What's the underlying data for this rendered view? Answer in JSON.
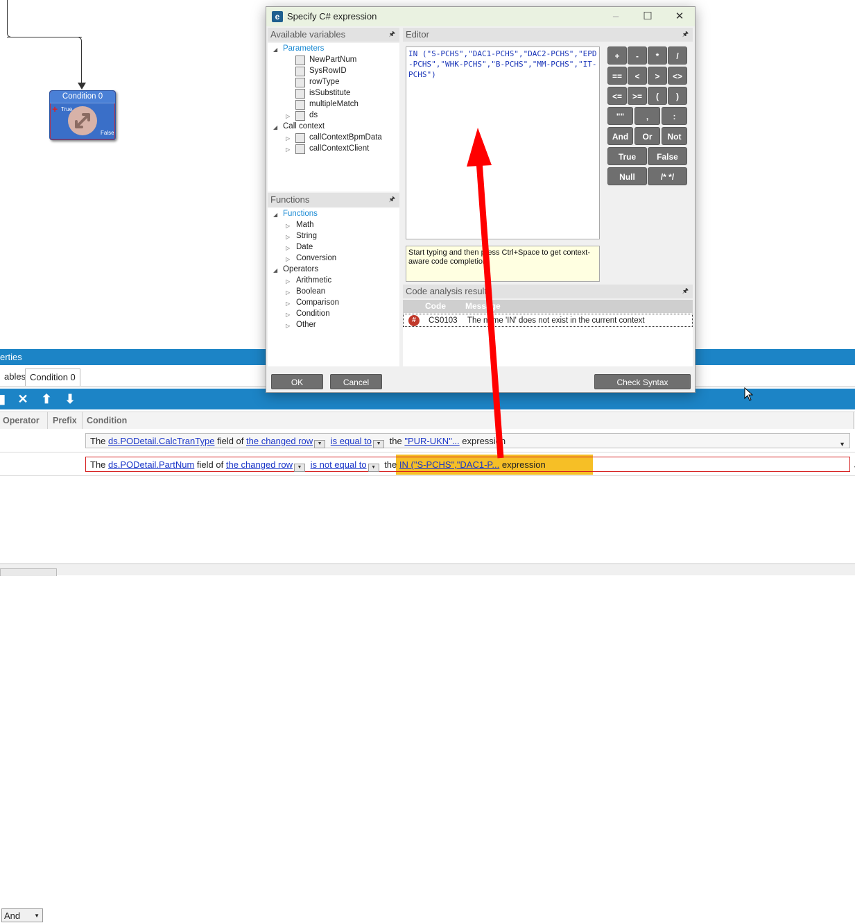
{
  "node": {
    "title": "Condition 0",
    "true_label": "True",
    "false_label": "False"
  },
  "properties": {
    "header": "erties",
    "tabs": [
      "ables",
      "Condition 0"
    ],
    "columns": {
      "operator": "Operator",
      "prefix": "Prefix",
      "condition": "Condition"
    },
    "rows": [
      {
        "operator": "",
        "parts": {
          "t1": "The",
          "field": "ds.PODetail.CalcTranType",
          "t2": "field of",
          "row": "the changed row",
          "op": "is equal to",
          "t3": "the",
          "value": "\"PUR-UKN\"...",
          "t4": "expression"
        }
      },
      {
        "operator": "And",
        "parts": {
          "t1": "The",
          "field": "ds.PODetail.PartNum",
          "t2": "field of",
          "row": "the changed row",
          "op": "is not equal to",
          "t3": "the",
          "value": "IN (\"S-PCHS\",\"DAC1-P...",
          "t4": "expression"
        }
      }
    ]
  },
  "dialog": {
    "title": "Specify C# expression",
    "vars_header": "Available variables",
    "tree_vars": {
      "parameters": "Parameters",
      "params": [
        "NewPartNum",
        "SysRowID",
        "rowType",
        "isSubstitute",
        "multipleMatch",
        "ds"
      ],
      "call_context": "Call context",
      "call_items": [
        "callContextBpmData",
        "callContextClient"
      ]
    },
    "functions_header": "Functions",
    "tree_funcs": {
      "functions": "Functions",
      "func_items": [
        "Math",
        "String",
        "Date",
        "Conversion"
      ],
      "operators": "Operators",
      "op_items": [
        "Arithmetic",
        "Boolean",
        "Comparison",
        "Condition",
        "Other"
      ]
    },
    "editor_header": "Editor",
    "editor_text": "IN (\"S-PCHS\",\"DAC1-PCHS\",\"DAC2-PCHS\",\"EPD-PCHS\",\"WHK-PCHS\",\"B-PCHS\",\"MM-PCHS\",\"IT-PCHS\")",
    "hint": "Start typing and then press Ctrl+Space to get context-aware code completion",
    "calc": [
      [
        "+",
        "-",
        "*",
        "/"
      ],
      [
        "==",
        "<",
        ">",
        "<>"
      ],
      [
        "<=",
        ">=",
        "(",
        ")"
      ],
      [
        "\"\"",
        ",",
        ":"
      ],
      [
        "And",
        "Or",
        "Not"
      ],
      [
        "True",
        "False"
      ],
      [
        "Null",
        "/* */"
      ]
    ],
    "analysis_header": "Code analysis results",
    "analysis_cols": {
      "code": "Code",
      "message": "Message"
    },
    "analysis_row": {
      "code": "CS0103",
      "message": "The name 'IN' does not exist in the current context"
    },
    "buttons": {
      "ok": "OK",
      "cancel": "Cancel",
      "check": "Check Syntax"
    }
  },
  "colors": {
    "accent": "#1c84c6",
    "highlight": "#f5b400",
    "arrow": "#ff0000",
    "error": "#c0392b"
  }
}
